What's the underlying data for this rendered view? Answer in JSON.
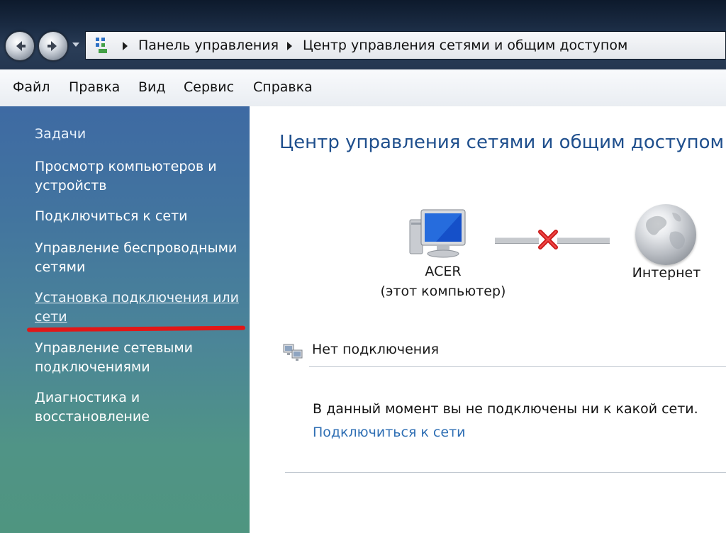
{
  "window": {
    "breadcrumbs": [
      "Панель управления",
      "Центр управления сетями и общим доступом"
    ]
  },
  "menu": [
    "Файл",
    "Правка",
    "Вид",
    "Сервис",
    "Справка"
  ],
  "sidebar": {
    "header": "Задачи",
    "items": [
      "Просмотр компьютеров и устройств",
      "Подключиться к сети",
      "Управление беспроводными сетями",
      "Установка подключения или сети",
      "Управление сетевыми подключениями",
      "Диагностика и восстановление"
    ]
  },
  "main": {
    "title": "Центр управления сетями и общим доступом",
    "map": {
      "computer_name": "ACER",
      "computer_sub": "(этот компьютер)",
      "internet_label": "Интернет",
      "connection_status": "disconnected"
    },
    "section": {
      "title": "Нет подключения",
      "message": "В данный момент вы не подключены ни к какой сети.",
      "link": "Подключиться к сети"
    }
  },
  "colors": {
    "title_blue": "#1f4f8d",
    "link_blue": "#2f6fb4",
    "annotation_red": "#e11717"
  }
}
